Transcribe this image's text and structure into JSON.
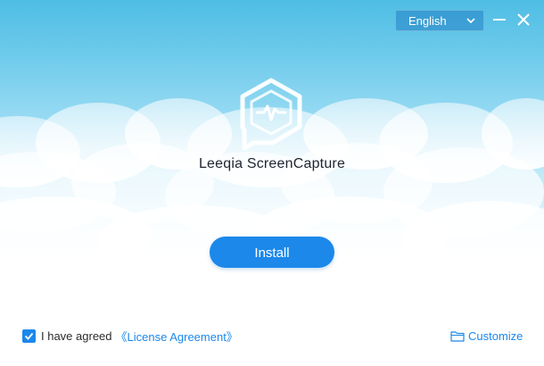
{
  "app": {
    "title": "Leeqia ScreenCapture"
  },
  "titlebar": {
    "language": "English",
    "minimize_icon": "minimize-icon",
    "close_icon": "close-icon"
  },
  "main": {
    "install_label": "Install"
  },
  "footer": {
    "agree_checked": true,
    "agree_text": "I have agreed",
    "license_link": "《License Agreement》",
    "customize_label": "Customize",
    "customize_icon": "folder-icon"
  },
  "colors": {
    "accent": "#1b88ea",
    "sky_top": "#4fbde4",
    "title_text": "#1f2430"
  }
}
